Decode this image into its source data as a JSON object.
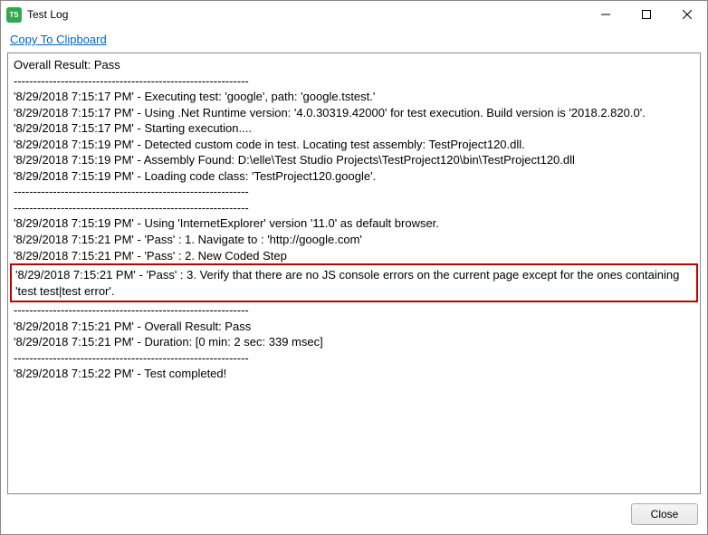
{
  "window": {
    "title": "Test Log"
  },
  "toolbar": {
    "copy_label": "Copy To Clipboard"
  },
  "log": {
    "overall": "Overall Result: Pass",
    "sep": "------------------------------------------------------------",
    "lines": [
      "'8/29/2018 7:15:17 PM' - Executing test: 'google', path: 'google.tstest.'",
      "'8/29/2018 7:15:17 PM' - Using .Net Runtime version: '4.0.30319.42000' for test execution. Build version is '2018.2.820.0'.",
      "'8/29/2018 7:15:17 PM' - Starting execution....",
      "'8/29/2018 7:15:19 PM' - Detected custom code in test. Locating test assembly: TestProject120.dll.",
      "'8/29/2018 7:15:19 PM' - Assembly Found: D:\\elle\\Test Studio Projects\\TestProject120\\bin\\TestProject120.dll",
      "'8/29/2018 7:15:19 PM' - Loading code class: 'TestProject120.google'."
    ],
    "lines2": [
      "'8/29/2018 7:15:19 PM' - Using 'InternetExplorer' version '11.0' as default browser.",
      "'8/29/2018 7:15:21 PM' - 'Pass' : 1. Navigate to : 'http://google.com'",
      "'8/29/2018 7:15:21 PM' - 'Pass' : 2. New Coded Step"
    ],
    "highlight": "'8/29/2018 7:15:21 PM' - 'Pass' : 3. Verify that there are no JS console errors on the current page except for the ones containing 'test test|test error'.",
    "lines3": [
      "'8/29/2018 7:15:21 PM' - Overall Result: Pass",
      "'8/29/2018 7:15:21 PM' - Duration: [0 min: 2 sec: 339 msec]"
    ],
    "final": "'8/29/2018 7:15:22 PM' - Test completed!"
  },
  "footer": {
    "close_label": "Close"
  }
}
